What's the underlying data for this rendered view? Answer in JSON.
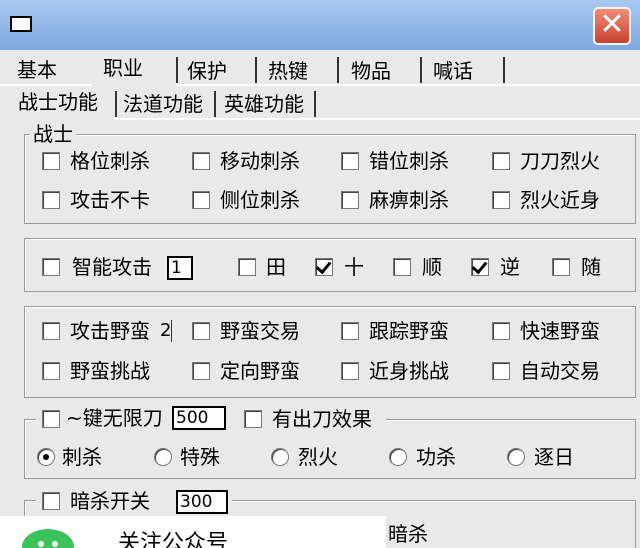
{
  "tabs_main": [
    "基本",
    "职业",
    "保护",
    "热键",
    "物品",
    "喊话"
  ],
  "tabs_sub": [
    "战士功能",
    "法道功能",
    "英雄功能"
  ],
  "group_warrior": {
    "title": "战士",
    "row1": [
      "格位刺杀",
      "移动刺杀",
      "错位刺杀",
      "刀刀烈火"
    ],
    "row2": [
      "攻击不卡",
      "侧位刺杀",
      "麻痹刺杀",
      "烈火近身"
    ]
  },
  "group_attack": {
    "smart_attack_label": "智能攻击",
    "smart_attack_value": "1",
    "dirs": [
      {
        "label": "田",
        "checked": false
      },
      {
        "label": "十",
        "checked": true
      },
      {
        "label": "顺",
        "checked": false
      },
      {
        "label": "逆",
        "checked": true
      },
      {
        "label": "随",
        "checked": false
      }
    ]
  },
  "group_barbarian": {
    "row1": [
      "攻击野蛮",
      "野蛮交易",
      "跟踪野蛮",
      "快速野蛮"
    ],
    "row1_spin_value": "2",
    "row2": [
      "野蛮挑战",
      "定向野蛮",
      "近身挑战",
      "自动交易"
    ]
  },
  "group_blade": {
    "hotkey_label": "~键无限刀",
    "hotkey_value": "500",
    "effect_label": "有出刀效果",
    "radios": [
      {
        "label": "刺杀",
        "checked": true
      },
      {
        "label": "特殊",
        "checked": false
      },
      {
        "label": "烈火",
        "checked": false
      },
      {
        "label": "功杀",
        "checked": false
      },
      {
        "label": "逐日",
        "checked": false
      }
    ]
  },
  "group_assassin": {
    "switch_label": "暗杀开关",
    "switch_value": "300",
    "partial_label": "暗杀"
  },
  "overlay": {
    "text": "关注公众号"
  },
  "colors": {
    "window_bg": "#e9e9e9",
    "title_gradient_top": "#a9c9f1",
    "close_button": "#c8412c"
  }
}
